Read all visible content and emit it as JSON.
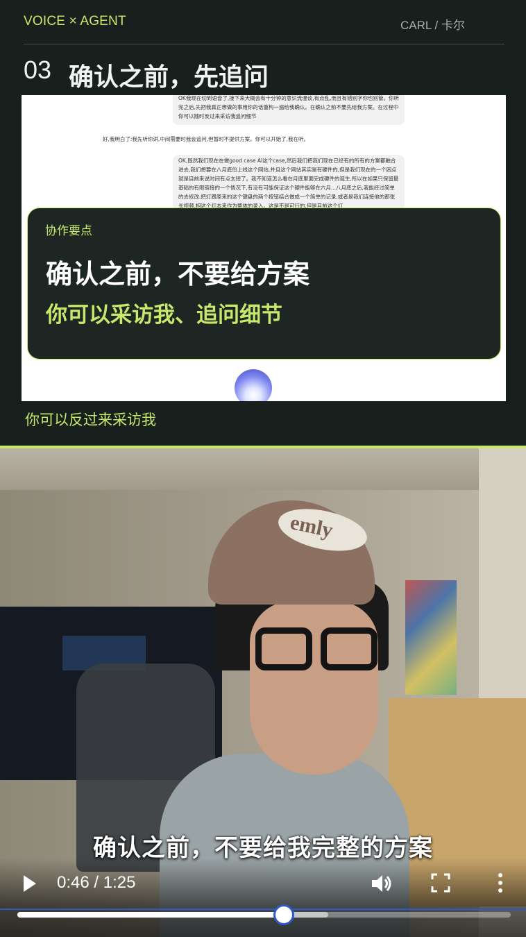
{
  "header": {
    "brand": "VOICE × AGENT",
    "author": "CARL / 卡尔",
    "section_number": "03",
    "section_title": "确认之前，先追问"
  },
  "chat_screenshot": {
    "bubble1": "OK我现在切到语音了,接下来大概会有十分钟的意识流漫谈,有点乱,而且有错别字你也别管。你听完之后,先把我真正想做的事用你的话重构一遍给我确认。在确认之前不要先给我方案。在过程中你可以随时反过来采访我追问细节",
    "reply": "好,我明白了:我先听你讲,中间需要时我会追问,但暂时不提供方案。你可以开始了,我在听。",
    "bubble2": "OK,既然我们现在在做good case AI这个case,然后我们把我们现在已经有的所有的方案都融合进去,我们想要在八月底份上线这个网站,并且这个网站其实是有硬件的,但是我们现在的一个困点就是目前来说时间有点太短了。我不知道怎么看在月底里面完成硬件的诞生,所以在如果只保留最基础的有限链接的一个情况下,有没有可能保证这个硬件能够在六月...八月底之后,我能经过简单的去修改,把灯跟原来的这个键盘的两个按钮结合做成一个简单的记录,或者是我们连接他的那张长视频,相这个灯本来作为整体的录入。这是不是可行的,但是目前这个灯"
  },
  "callout": {
    "eyebrow": "协作要点",
    "title": "确认之前，不要给方案",
    "subtitle": "你可以采访我、追问细节"
  },
  "slide_caption": "你可以反过来采访我",
  "video": {
    "cap_text": "emly",
    "subtitle": "确认之前，不要给我完整的方案",
    "current_time": "0:46",
    "separator": "/",
    "duration": "1:25",
    "progress_fraction": 0.54,
    "buffered_fraction": 0.63
  },
  "colors": {
    "accent": "#c7e96b",
    "background": "#17201d",
    "progress_blue": "#2f57c9"
  }
}
